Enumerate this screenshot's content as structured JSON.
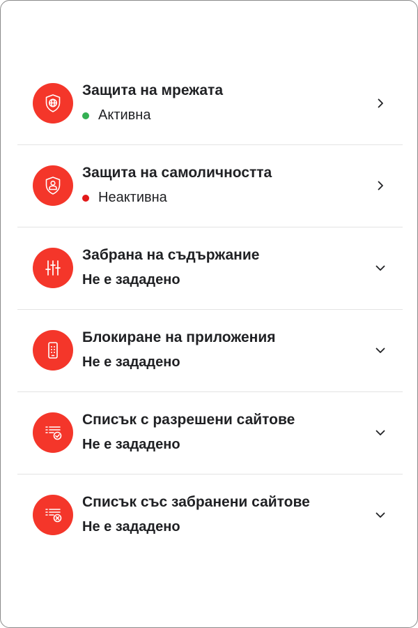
{
  "colors": {
    "accent": "#f4362a",
    "active": "#34b053",
    "inactive": "#e21a1a",
    "text": "#202124"
  },
  "items": [
    {
      "title": "Защита на мрежата",
      "status": "Активна",
      "status_color": "#34b053",
      "icon": "globe-shield-icon",
      "chevron": "chevron-right-icon"
    },
    {
      "title": "Защита на самоличността",
      "status": "Неактивна",
      "status_color": "#e21a1a",
      "icon": "user-shield-icon",
      "chevron": "chevron-right-icon"
    },
    {
      "title": "Забрана на съдържание",
      "status": "Не е зададено",
      "icon": "sliders-icon",
      "chevron": "chevron-down-icon"
    },
    {
      "title": "Блокиране на приложения",
      "status": "Не е зададено",
      "icon": "phone-apps-icon",
      "chevron": "chevron-down-icon"
    },
    {
      "title": "Списък с разрешени сайтове",
      "status": "Не е зададено",
      "icon": "allowlist-check-icon",
      "chevron": "chevron-down-icon"
    },
    {
      "title": "Списък със забранени сайтове",
      "status": "Не е зададено",
      "icon": "blocklist-x-icon",
      "chevron": "chevron-down-icon"
    }
  ]
}
